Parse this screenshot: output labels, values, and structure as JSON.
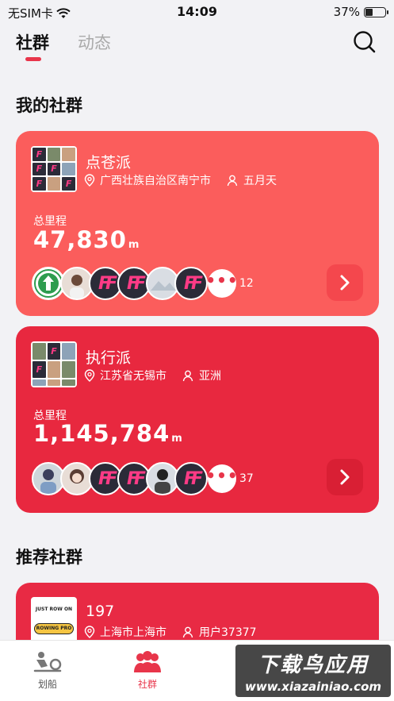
{
  "status_bar": {
    "carrier": "无SIM卡",
    "time": "14:09",
    "battery": "37%",
    "battery_level": 0.37
  },
  "tabs": [
    {
      "label": "社群",
      "active": true
    },
    {
      "label": "动态",
      "active": false
    }
  ],
  "icons": {
    "search": "search-icon",
    "location": "location-pin-icon",
    "person": "person-icon",
    "arrow": "chevron-right-icon"
  },
  "my_groups_title": "我的社群",
  "recommended_title": "推荐社群",
  "groups": [
    {
      "name": "点苍派",
      "location": "广西壮族自治区南宁市",
      "owner": "五月天",
      "distance_label": "总里程",
      "distance_value": "47,830",
      "unit": "m",
      "member_count": "12",
      "color": "#fb5d5c"
    },
    {
      "name": "执行派",
      "location": "江苏省无锡市",
      "owner": "亚洲",
      "distance_label": "总里程",
      "distance_value": "1,145,784",
      "unit": "m",
      "member_count": "37",
      "color": "#e8283f"
    }
  ],
  "recommended": [
    {
      "name": "197",
      "location": "上海市上海市",
      "owner": "用户37377",
      "logo_top": "JUST ROW ON",
      "logo_text": "ROWING PRO"
    }
  ],
  "more_dots": "•••",
  "bottom_nav": [
    {
      "label": "划船",
      "active": false
    },
    {
      "label": "社群",
      "active": true
    }
  ],
  "watermark": {
    "line1": "下载鸟应用",
    "line2": "www.xiazainiao.com"
  },
  "accent_color": "#e8354a"
}
